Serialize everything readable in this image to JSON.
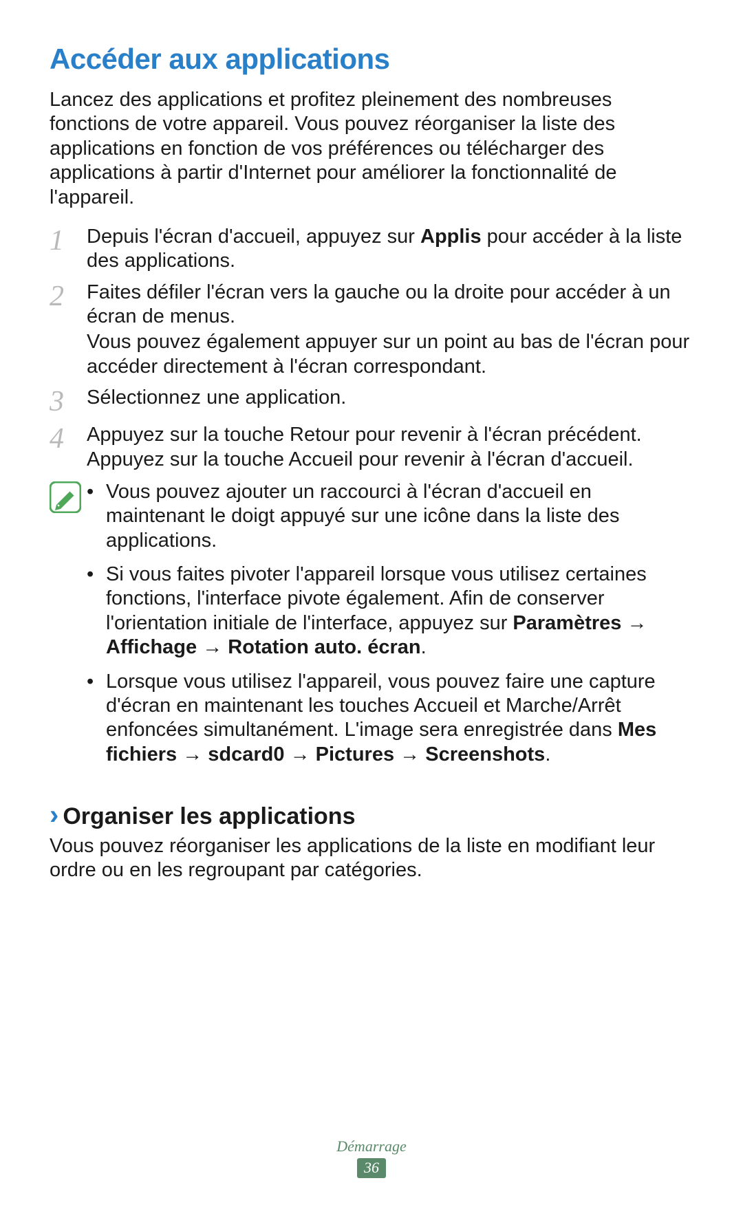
{
  "title": "Accéder aux applications",
  "intro": "Lancez des applications et profitez pleinement des nombreuses fonctions de votre appareil. Vous pouvez réorganiser la liste des applications en fonction de vos préférences ou télécharger des applications à partir d'Internet pour améliorer la fonctionnalité de l'appareil.",
  "steps": {
    "s1": {
      "num": "1",
      "a": "Depuis l'écran d'accueil, appuyez sur ",
      "b": "Applis",
      "c": " pour accéder à la liste des applications."
    },
    "s2": {
      "num": "2",
      "line1": "Faites défiler l'écran vers la gauche ou la droite pour accéder à un écran de menus.",
      "line2": "Vous pouvez également appuyer sur un point au bas de l'écran pour accéder directement à l'écran correspondant."
    },
    "s3": {
      "num": "3",
      "text": "Sélectionnez une application."
    },
    "s4": {
      "num": "4",
      "text": "Appuyez sur la touche Retour pour revenir à l'écran précédent. Appuyez sur la touche Accueil pour revenir à l'écran d'accueil."
    }
  },
  "arrow": "→",
  "tips": {
    "t1": "Vous pouvez ajouter un raccourci à l'écran d'accueil en maintenant le doigt appuyé sur une icône dans la liste des applications.",
    "t2": {
      "pre": "Si vous faites pivoter l'appareil lorsque vous utilisez certaines fonctions, l'interface pivote également. Afin de conserver l'orientation initiale de l'interface, appuyez sur ",
      "p1": "Paramètres",
      "p2": "Affichage",
      "p3": "Rotation auto. écran",
      "post": "."
    },
    "t3": {
      "pre": "Lorsque vous utilisez l'appareil, vous pouvez faire une capture d'écran en maintenant les touches Accueil et Marche/Arrêt enfoncées simultanément. L'image sera enregistrée dans ",
      "p1": "Mes fichiers",
      "p2": "sdcard0",
      "p3": "Pictures",
      "p4": "Screenshots",
      "post": "."
    }
  },
  "sub": {
    "chevron": "›",
    "title": "Organiser les applications",
    "intro": "Vous pouvez réorganiser les applications de la liste en modifiant leur ordre ou en les regroupant par catégories."
  },
  "footer": {
    "chapter": "Démarrage",
    "page": "36"
  }
}
